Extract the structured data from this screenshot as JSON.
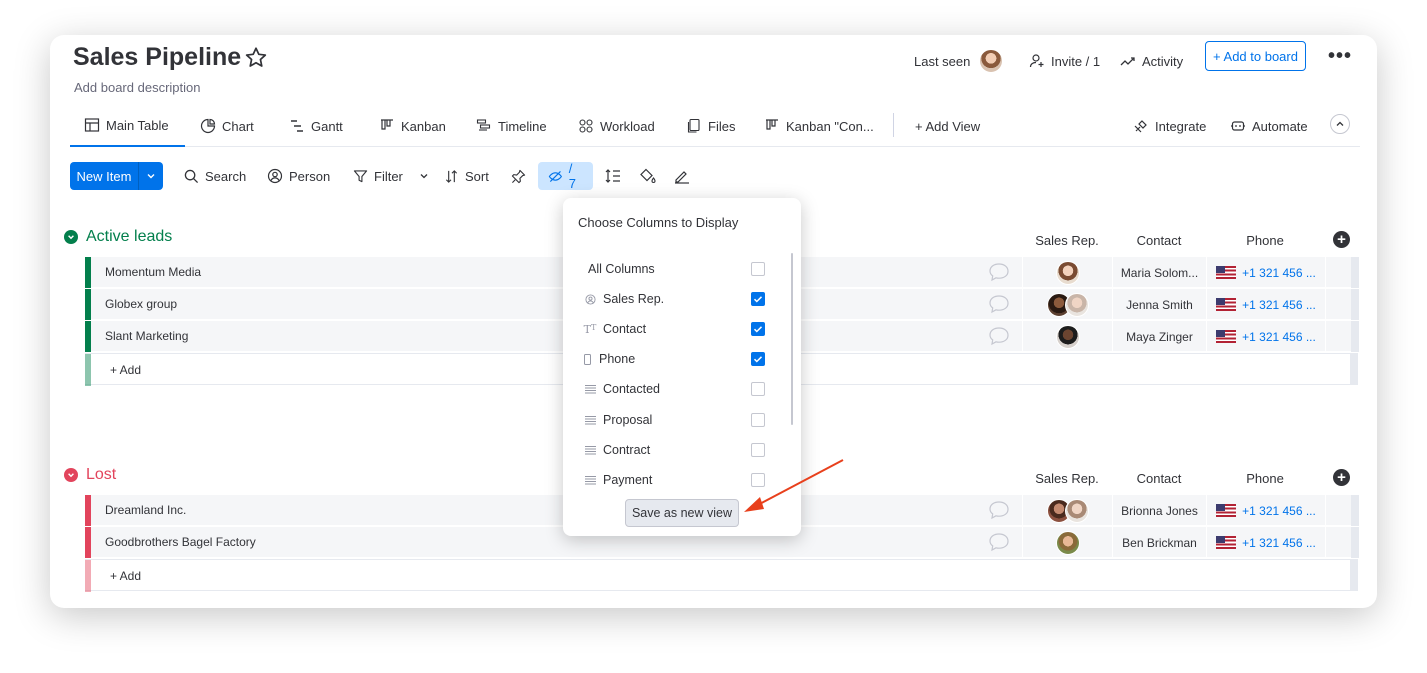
{
  "board": {
    "title": "Sales Pipeline",
    "description": "Add board description",
    "last_seen_label": "Last seen",
    "invite_label": "Invite / 1",
    "activity_label": "Activity",
    "add_to_board_label": "+ Add to board",
    "more_label": "•••"
  },
  "tabs": [
    {
      "label": "Main Table",
      "icon": "table-icon"
    },
    {
      "label": "Chart",
      "icon": "chart-icon"
    },
    {
      "label": "Gantt",
      "icon": "gantt-icon"
    },
    {
      "label": "Kanban",
      "icon": "kanban-icon"
    },
    {
      "label": "Timeline",
      "icon": "timeline-icon"
    },
    {
      "label": "Workload",
      "icon": "workload-icon"
    },
    {
      "label": "Files",
      "icon": "files-icon"
    },
    {
      "label": "Kanban \"Con...",
      "icon": "kanban-icon"
    },
    {
      "label": "+ Add View",
      "icon": ""
    },
    {
      "label": "Integrate",
      "icon": "integrate-icon"
    },
    {
      "label": "Automate",
      "icon": "automate-icon"
    }
  ],
  "toolbar": {
    "new_item_label": "New Item",
    "search_label": "Search",
    "person_label": "Person",
    "filter_label": "Filter",
    "sort_label": "Sort",
    "hidden_label": "/ 7"
  },
  "columns": {
    "sales_rep": "Sales Rep.",
    "contact": "Contact",
    "phone": "Phone"
  },
  "groups": [
    {
      "title": "Active leads",
      "color": "#037f4c",
      "add_label": "+ Add",
      "rows": [
        {
          "name": "Momentum Media",
          "contact": "Maria Solom...",
          "phone": "+1 321 456 ..."
        },
        {
          "name": "Globex group",
          "contact": "Jenna Smith",
          "phone": "+1 321 456 ..."
        },
        {
          "name": "Slant Marketing",
          "contact": "Maya Zinger",
          "phone": "+1 321 456 ..."
        }
      ]
    },
    {
      "title": "Lost",
      "color": "#e2445c",
      "add_label": "+ Add",
      "rows": [
        {
          "name": "Dreamland Inc.",
          "contact": "Brionna Jones",
          "phone": "+1 321 456 ..."
        },
        {
          "name": "Goodbrothers Bagel Factory",
          "contact": "Ben Brickman",
          "phone": "+1 321 456 ..."
        }
      ]
    }
  ],
  "popup": {
    "title": "Choose Columns to Display",
    "options": [
      {
        "label": "All Columns",
        "checked": false,
        "icon": ""
      },
      {
        "label": "Sales Rep.",
        "checked": true,
        "icon": "person-icon"
      },
      {
        "label": "Contact",
        "checked": true,
        "icon": "text-icon"
      },
      {
        "label": "Phone",
        "checked": true,
        "icon": "phone-icon"
      },
      {
        "label": "Contacted",
        "checked": false,
        "icon": "status-icon"
      },
      {
        "label": "Proposal",
        "checked": false,
        "icon": "status-icon"
      },
      {
        "label": "Contract",
        "checked": false,
        "icon": "status-icon"
      },
      {
        "label": "Payment",
        "checked": false,
        "icon": "status-icon"
      }
    ],
    "save_label": "Save as new view"
  },
  "colors": {
    "accent": "#0073ea",
    "arrow": "#e8401c"
  }
}
